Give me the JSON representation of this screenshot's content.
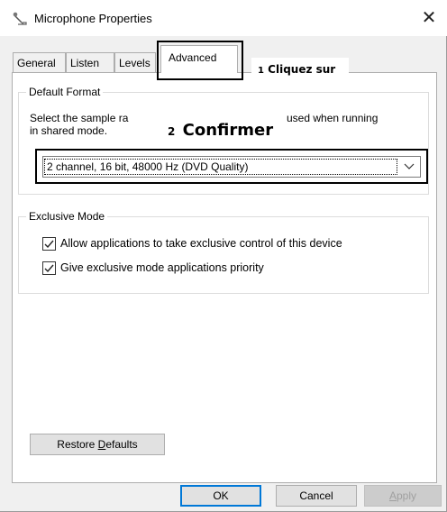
{
  "window": {
    "title": "Microphone Properties",
    "close_glyph": "✕",
    "icon": "microphone-icon"
  },
  "tabs": [
    {
      "label": "General",
      "selected": false
    },
    {
      "label": "Listen",
      "selected": false
    },
    {
      "label": "Levels",
      "selected": false
    },
    {
      "label": "Advanced",
      "selected": true
    }
  ],
  "annotations": {
    "step1_number": "1",
    "step1_text": "Cliquez sur",
    "step2_number": "2",
    "step2_text": "Confirmer"
  },
  "default_format": {
    "group_label": "Default Format",
    "description_part1": "Select the sample ra",
    "description_part2": "used when running",
    "description_line2": "in shared mode.",
    "selected_value": "2 channel, 16 bit, 48000 Hz (DVD Quality)"
  },
  "exclusive_mode": {
    "group_label": "Exclusive Mode",
    "options": [
      {
        "label": "Allow applications to take exclusive control of this device",
        "checked": true
      },
      {
        "label": "Give exclusive mode applications priority",
        "checked": true
      }
    ]
  },
  "buttons": {
    "restore_pre": "Restore ",
    "restore_accel": "D",
    "restore_post": "efaults",
    "ok": "OK",
    "cancel": "Cancel",
    "apply_accel": "A",
    "apply_post": "pply"
  },
  "colors": {
    "focus_border": "#0078d7",
    "highlight_box": "#000000"
  }
}
